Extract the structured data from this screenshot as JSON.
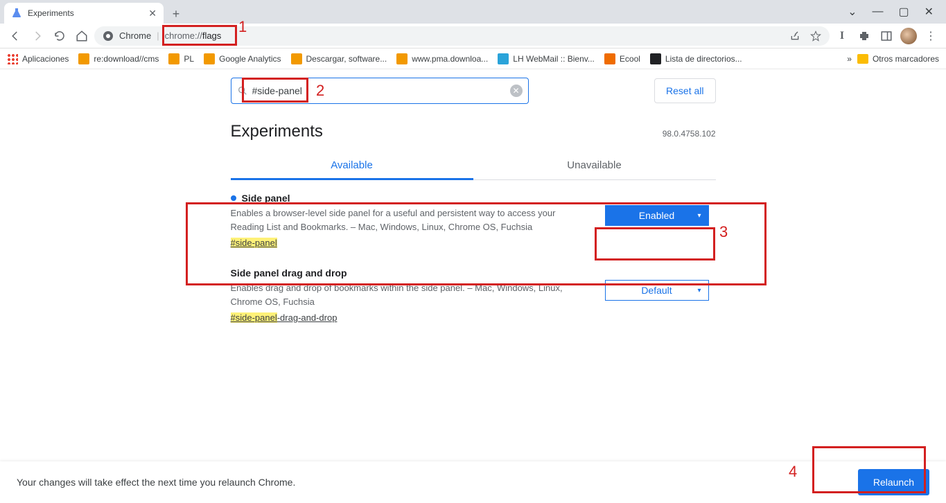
{
  "tab": {
    "title": "Experiments"
  },
  "omnibox": {
    "site": "Chrome",
    "url_prefix": "chrome://",
    "url_path": "flags"
  },
  "bookmarks": {
    "apps": "Aplicaciones",
    "items": [
      {
        "label": "re:download//cms",
        "color": "#f29900"
      },
      {
        "label": "PL",
        "color": "#f29900"
      },
      {
        "label": "Google Analytics",
        "color": "#f29900"
      },
      {
        "label": "Descargar, software...",
        "color": "#f29900"
      },
      {
        "label": "www.pma.downloa...",
        "color": "#f29900"
      },
      {
        "label": "LH WebMail :: Bienv...",
        "color": "#2aa3d9"
      },
      {
        "label": "Ecool",
        "color": "#ef6c00"
      },
      {
        "label": "Lista de directorios...",
        "color": "#202124"
      }
    ],
    "other": "Otros marcadores"
  },
  "search": {
    "value": "#side-panel",
    "reset": "Reset all"
  },
  "header": {
    "title": "Experiments",
    "version": "98.0.4758.102"
  },
  "tabs": {
    "available": "Available",
    "unavailable": "Unavailable"
  },
  "flags": [
    {
      "title": "Side panel",
      "desc": "Enables a browser-level side panel for a useful and persistent way to access your Reading List and Bookmarks. – Mac, Windows, Linux, Chrome OS, Fuchsia",
      "hash_hl": "#side-panel",
      "hash_rest": "",
      "dropdown": "Enabled",
      "modified": true
    },
    {
      "title": "Side panel drag and drop",
      "desc": "Enables drag and drop of bookmarks within the side panel. – Mac, Windows, Linux, Chrome OS, Fuchsia",
      "hash_hl": "#side-panel",
      "hash_rest": "-drag-and-drop",
      "dropdown": "Default",
      "modified": false
    }
  ],
  "bottom": {
    "msg": "Your changes will take effect the next time you relaunch Chrome.",
    "relaunch": "Relaunch"
  },
  "annotations": {
    "n1": "1",
    "n2": "2",
    "n3": "3",
    "n4": "4"
  }
}
